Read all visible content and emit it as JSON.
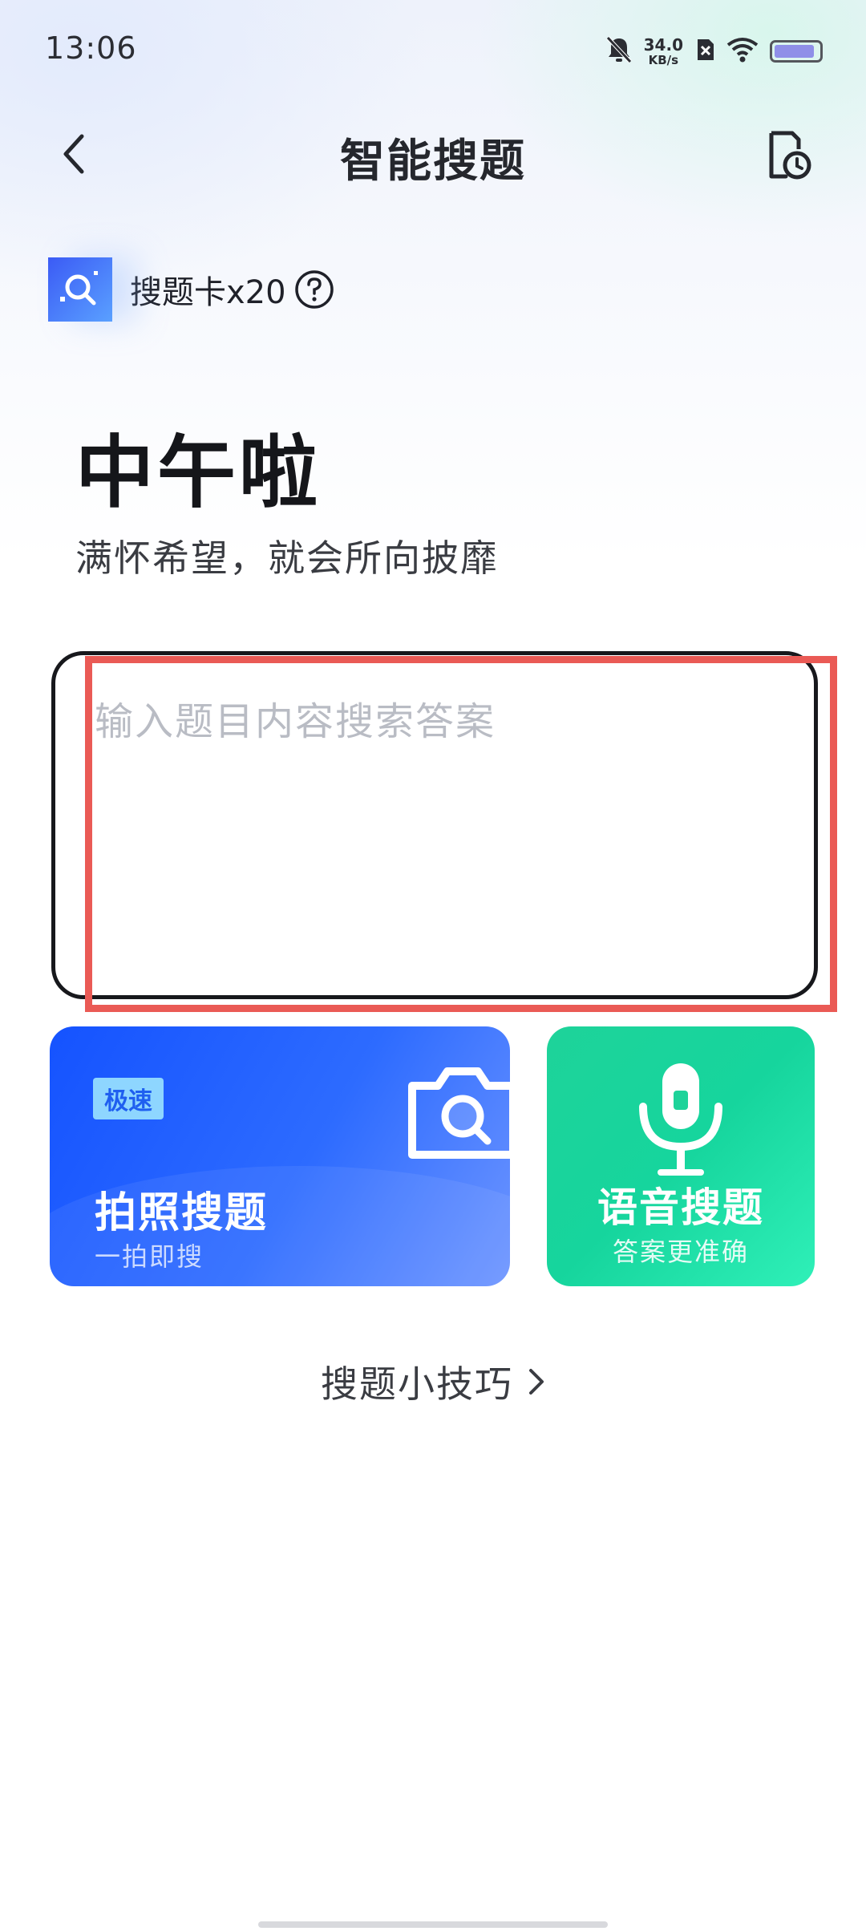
{
  "status_bar": {
    "time": "13:06",
    "net_speed_value": "34.0",
    "net_speed_unit": "KB/s",
    "battery_level": 0.9
  },
  "header": {
    "title": "智能搜题"
  },
  "search_card": {
    "label": "搜题卡x20"
  },
  "greeting": {
    "title": "中午啦",
    "subtitle": "满怀希望，就会所向披靡"
  },
  "search_box": {
    "placeholder": "输入题目内容搜索答案"
  },
  "photo_search": {
    "badge": "极速",
    "title": "拍照搜题",
    "subtitle": "一拍即搜"
  },
  "voice_search": {
    "title": "语音搜题",
    "subtitle": "答案更准确"
  },
  "tips": {
    "label": "搜题小技巧"
  },
  "colors": {
    "photo_card": "#1553ff",
    "voice_card": "#16d59d",
    "highlight": "#ea5a55"
  }
}
